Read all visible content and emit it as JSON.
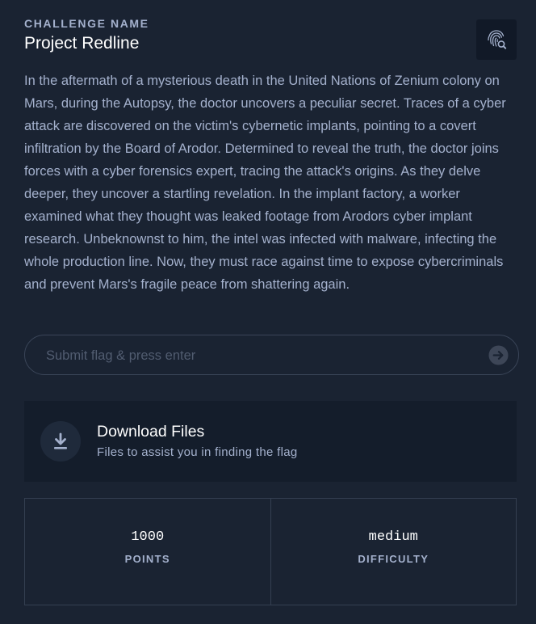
{
  "challenge": {
    "label": "CHALLENGE NAME",
    "name": "Project Redline",
    "description": "In the aftermath of a mysterious death in the United Nations of Zenium colony on Mars, during the Autopsy, the doctor uncovers a peculiar secret. Traces of a cyber attack are discovered on the victim's cybernetic implants, pointing to a covert infiltration by the Board of Arodor. Determined to reveal the truth, the doctor joins forces with a cyber forensics expert, tracing the attack's origins. As they delve deeper, they uncover a startling revelation. In the implant factory, a worker examined what they thought was leaked footage from Arodors cyber implant research. Unbeknownst to him, the intel was infected with malware, infecting the whole production line. Now, they must race against time to expose cybercriminals and prevent Mars's fragile peace from shattering again.",
    "category_icon": "fingerprint-search-icon"
  },
  "flag": {
    "placeholder": "Submit flag & press enter",
    "value": "",
    "submit_icon": "arrow-right-circle-icon"
  },
  "downloads": {
    "title": "Download Files",
    "subtitle": "Files to assist you in finding the flag",
    "icon": "download-icon"
  },
  "stats": [
    {
      "value": "1000",
      "label": "POINTS"
    },
    {
      "value": "medium",
      "label": "DIFFICULTY"
    }
  ],
  "colors": {
    "background": "#1a2332",
    "card": "#141d2b",
    "text_primary": "#ffffff",
    "text_secondary": "#a4b1cd",
    "border": "#343f51"
  }
}
